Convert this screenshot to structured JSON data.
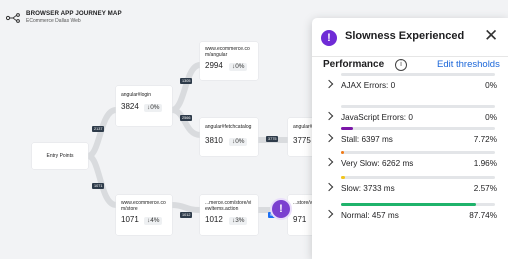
{
  "map": {
    "title": "BROWSER APP JOURNEY MAP",
    "subtitle": "ECommerce Dallas Web",
    "entry_label": "Entry Points",
    "nodes": {
      "login": {
        "name": "angular#login",
        "metric": "3824",
        "pct": "↓0%"
      },
      "angular": {
        "name": "www.ecommerce.co m/angular",
        "metric": "2994",
        "pct": "↓0%"
      },
      "fetchcatalog": {
        "name": "angular#fetchcatalog",
        "metric": "3810",
        "pct": "↓0%"
      },
      "angular_r": {
        "name": "angular#",
        "metric": "3775",
        "pct": ""
      },
      "store": {
        "name": "www.ecommerce.co m/store",
        "metric": "1071",
        "pct": "↓4%"
      },
      "viewitems": {
        "name": "...merce.com/store/vi ewItems.action",
        "metric": "1012",
        "pct": "↓3%"
      },
      "storeact": {
        "name": "...store/va tocart.act",
        "metric": "971",
        "pct": ""
      }
    },
    "counts": {
      "c1": "2137",
      "c2": "1305",
      "c3": "2566",
      "c4": "1071",
      "c5": "3775",
      "c6": "1012",
      "c7": "971"
    },
    "alert_glyph": "!"
  },
  "panel": {
    "title": "Slowness Experienced",
    "warn_glyph": "!",
    "close_glyph": "✕",
    "performance_label": "Performance",
    "info_glyph": "i",
    "edit_label": "Edit thresholds",
    "rows": [
      {
        "label": "AJAX Errors: 0",
        "value": "0%",
        "fraction": 0.0,
        "color": "#d8dbe0"
      },
      {
        "label": "JavaScript Errors: 0",
        "value": "0%",
        "fraction": 0.0,
        "color": "#d8dbe0"
      },
      {
        "label": "Stall: 6397 ms",
        "value": "7.72%",
        "fraction": 0.0772,
        "color": "#7b16a8"
      },
      {
        "label": "Very Slow: 6262 ms",
        "value": "1.96%",
        "fraction": 0.0196,
        "color": "#f07a17"
      },
      {
        "label": "Slow: 3733 ms",
        "value": "2.57%",
        "fraction": 0.0257,
        "color": "#f2c51c"
      },
      {
        "label": "Normal: 457 ms",
        "value": "87.74%",
        "fraction": 0.8774,
        "color": "#1fb36b"
      }
    ]
  }
}
